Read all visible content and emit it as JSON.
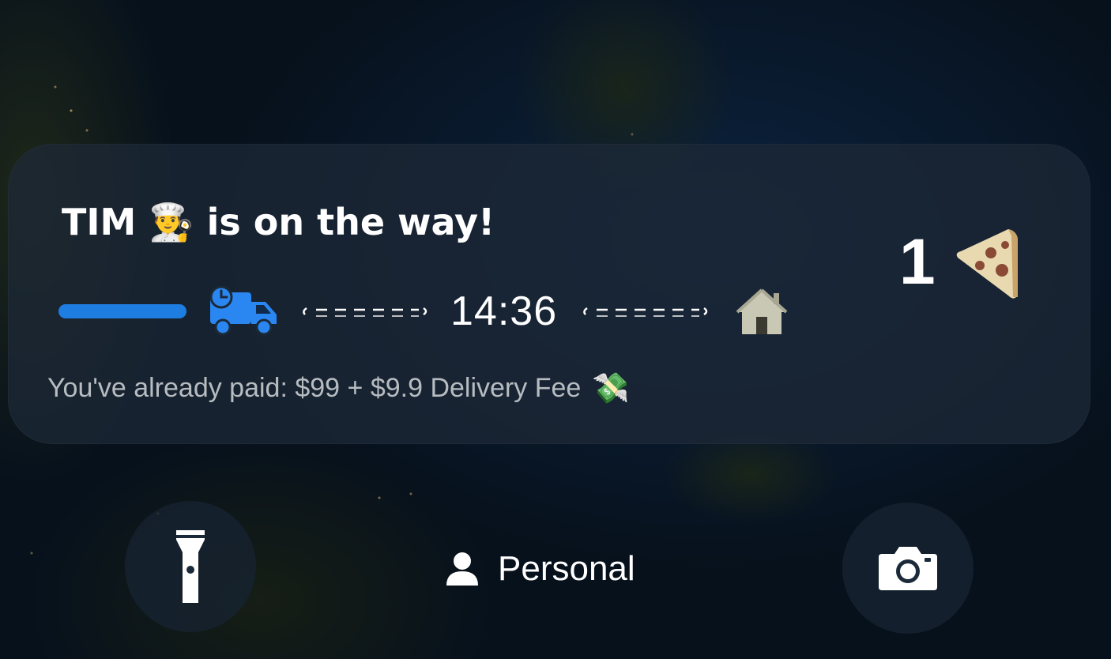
{
  "delivery": {
    "driver_name": "TIM",
    "driver_emoji": "👨‍🍳",
    "status_text": "is on the way!",
    "eta": "14:36",
    "progress": 0.25,
    "accent_color": "#1e7de0",
    "paid_text": "You've already paid: $99 + $9.9 Delivery Fee",
    "paid_emoji": "💸",
    "item_count": "1",
    "item_icon": "pizza-slice-icon",
    "vehicle_icon": "delivery-truck-icon",
    "destination_icon": "house-icon"
  },
  "lock_screen": {
    "flashlight_icon": "flashlight-icon",
    "camera_icon": "camera-icon",
    "focus_mode_label": "Personal",
    "focus_mode_icon": "person-icon"
  }
}
